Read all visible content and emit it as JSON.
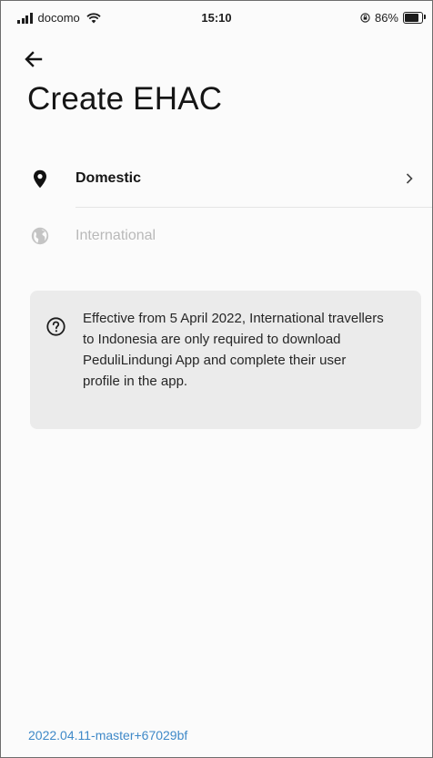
{
  "status_bar": {
    "carrier": "docomo",
    "time": "15:10",
    "battery": "86%",
    "battery_level": 0.86
  },
  "header": {
    "back_icon": "arrow-left-icon",
    "title": "Create EHAC"
  },
  "menu": {
    "items": [
      {
        "label": "Domestic",
        "icon": "location-pin-icon",
        "trailing_icon": "chevron-right-icon",
        "enabled": true
      },
      {
        "label": "International",
        "icon": "globe-icon",
        "enabled": false
      }
    ]
  },
  "info_card": {
    "icon": "question-circle-icon",
    "text": "Effective from 5 April 2022, International travellers to Indonesia are only required to download PeduliLindungi App and complete their user profile in the app."
  },
  "footer": {
    "version": "2022.04.11-master+67029bf"
  },
  "colors": {
    "background": "#fbfbfb",
    "card": "#ebebeb",
    "disabled_text": "#b9b9b9",
    "version_link": "#3f89c8"
  }
}
